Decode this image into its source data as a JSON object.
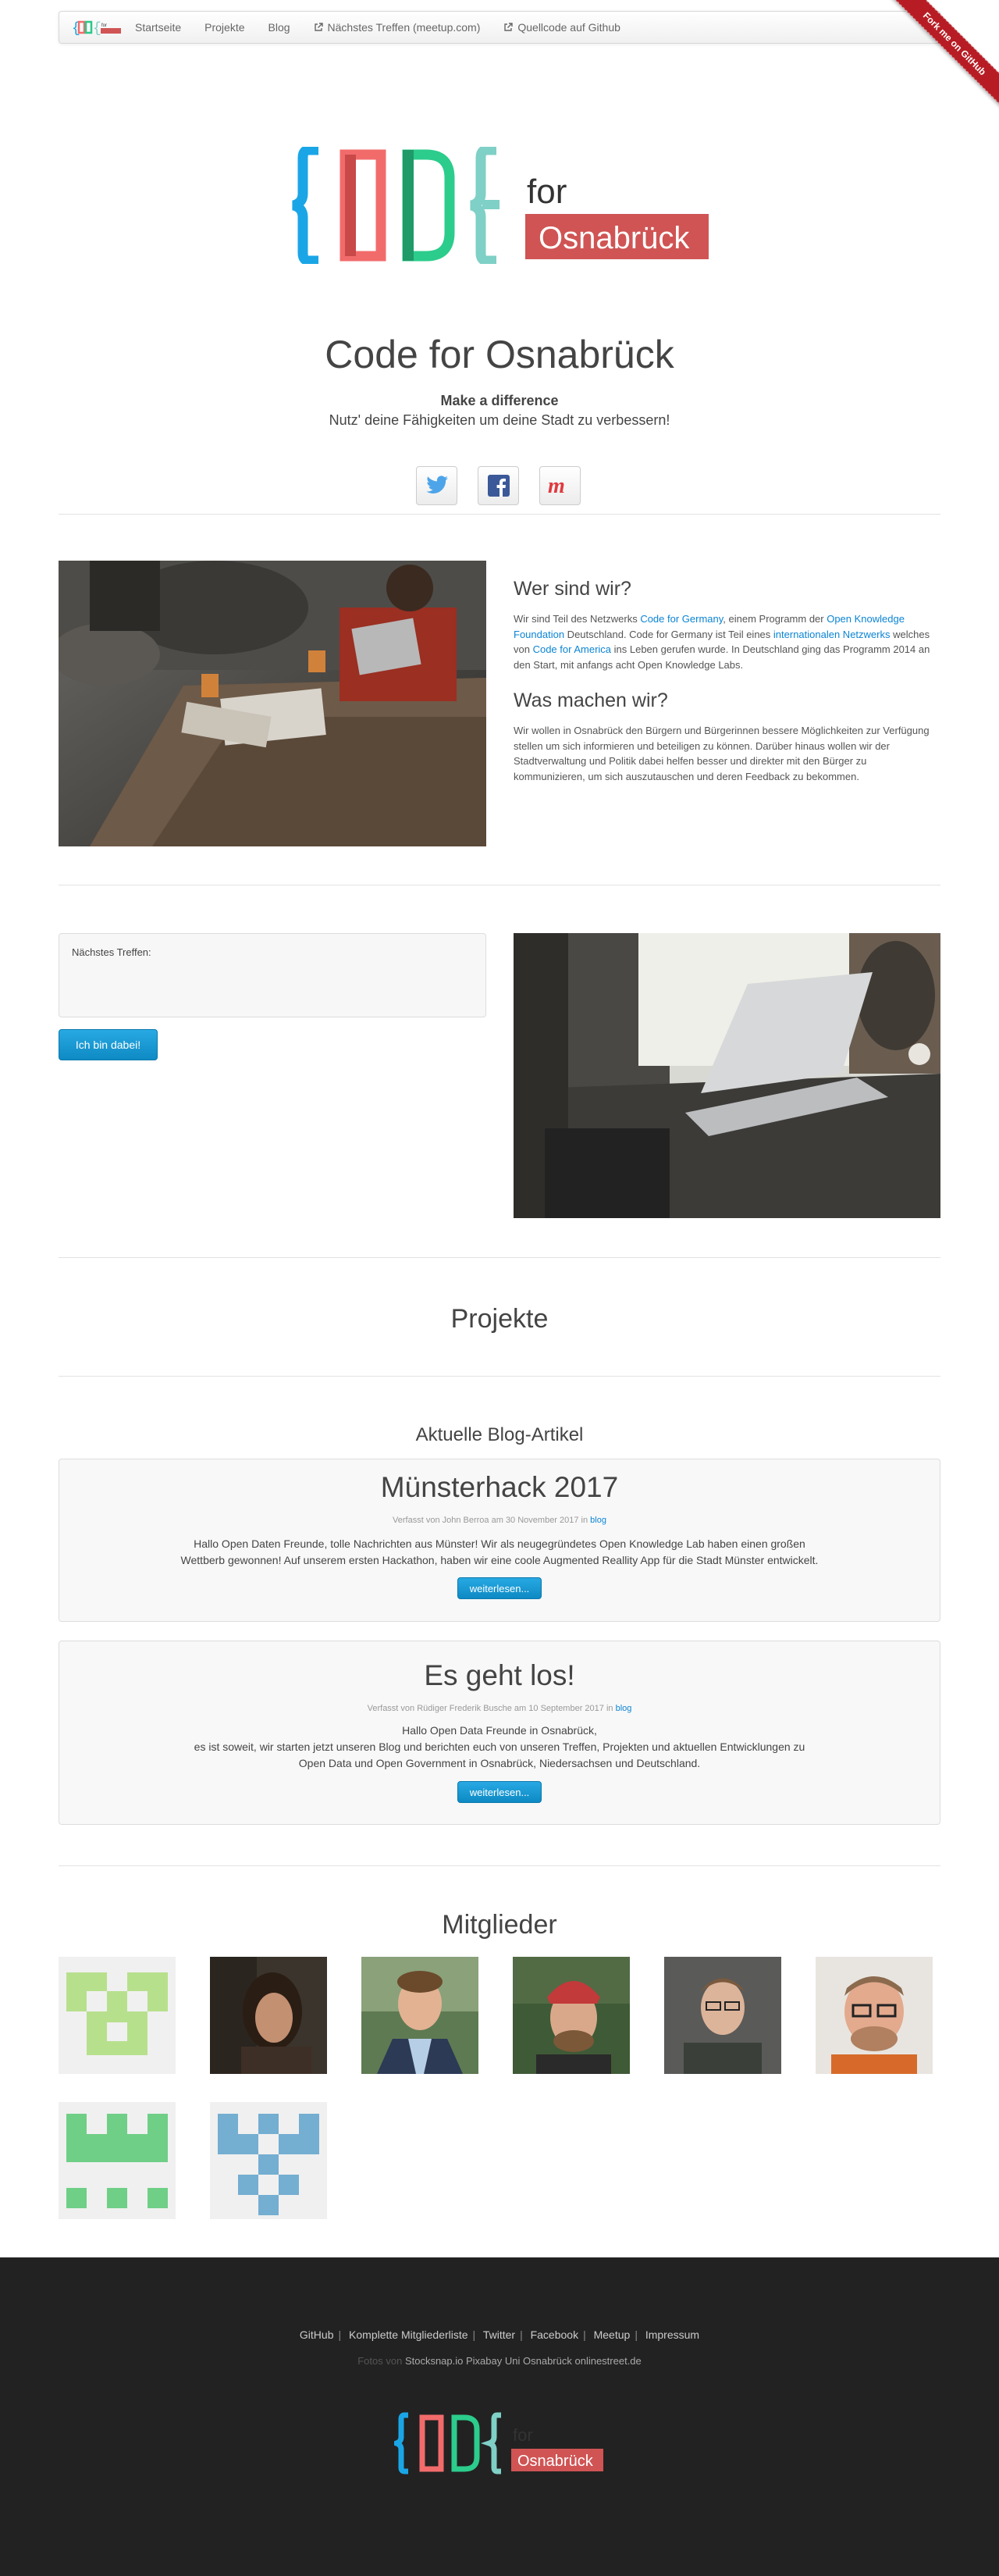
{
  "nav": {
    "items": [
      "Startseite",
      "Projekte",
      "Blog"
    ],
    "meetup": "Nächstes Treffen (meetup.com)",
    "github": "Quellcode auf Github"
  },
  "ribbon": "Fork me on GitHub",
  "logo": {
    "for": "for",
    "city": "Osnabrück"
  },
  "hero": {
    "title": "Code for Osnabrück",
    "tagline": "Make a difference",
    "subline": "Nutz' deine Fähigkeiten um deine Stadt zu verbessern!"
  },
  "social": {
    "twitter": "twitter-icon",
    "facebook": "facebook-icon",
    "meetup": "meetup-icon"
  },
  "about": {
    "who_heading": "Wer sind wir?",
    "who_p1": "Wir sind Teil des Netzwerks ",
    "who_link1": "Code for Germany",
    "who_p2": ", einem Programm der ",
    "who_link2": "Open Knowledge Foundation",
    "who_p3": " Deutschland. Code for Germany ist Teil eines ",
    "who_link3": "internationalen Netzwerks",
    "who_p4": " welches von ",
    "who_link4": "Code for America",
    "who_p5": " ins Leben gerufen wurde. In Deutschland ging das Programm 2014 an den Start, mit anfangs acht Open Knowledge Labs.",
    "what_heading": "Was machen wir?",
    "what_text": "Wir wollen in Osnabrück den Bürgern und Bürgerinnen bessere Möglichkeiten zur Verfügung stellen um sich informieren und beteiligen zu können. Darüber hinaus wollen wir der Stadtverwaltung und Politik dabei helfen besser und direkter mit den Bürger zu kommunizieren, um sich auszutauschen und deren Feedback zu bekommen."
  },
  "meetup": {
    "label": "Nächstes Treffen:",
    "button": "Ich bin dabei!"
  },
  "projects": {
    "title": "Projekte"
  },
  "blog": {
    "title": "Aktuelle Blog-Artikel",
    "posts": [
      {
        "title": "Münsterhack 2017",
        "meta": "Verfasst von John Berroa am 30 November 2017 in ",
        "category": "blog",
        "body": "Hallo Open Daten Freunde, tolle Nachrichten aus Münster! Wir als neugegründetes Open Knowledge Lab haben einen großen Wettberb gewonnen! Auf unserem ersten Hackathon, haben wir eine coole Augmented Reallity App für die Stadt Münster entwickelt.",
        "button": "weiterlesen..."
      },
      {
        "title": "Es geht los!",
        "meta": "Verfasst von Rüdiger Frederik Busche am 10 September 2017 in ",
        "category": "blog",
        "body1": "Hallo Open Data Freunde in Osnabrück,",
        "body2": "es ist soweit, wir starten jetzt unseren Blog und berichten euch von unseren Treffen, Projekten und aktuellen Entwicklungen zu Open Data und Open Government in Osnabrück, Niedersachsen und Deutschland.",
        "button": "weiterlesen..."
      }
    ]
  },
  "members": {
    "title": "Mitglieder"
  },
  "footer": {
    "links": [
      "GitHub",
      "Komplette Mitgliederliste",
      "Twitter",
      "Facebook",
      "Meetup",
      "Impressum"
    ],
    "credits_prefix": "Fotos von",
    "credits": [
      "Stocksnap.io",
      "Pixabay",
      "Uni Osnabrück",
      "onlinestreet.de"
    ]
  },
  "colors": {
    "accent": "#0b84d4",
    "button": "#1a9bd7",
    "footer_bg": "#222222",
    "brand_red": "#d05454"
  }
}
